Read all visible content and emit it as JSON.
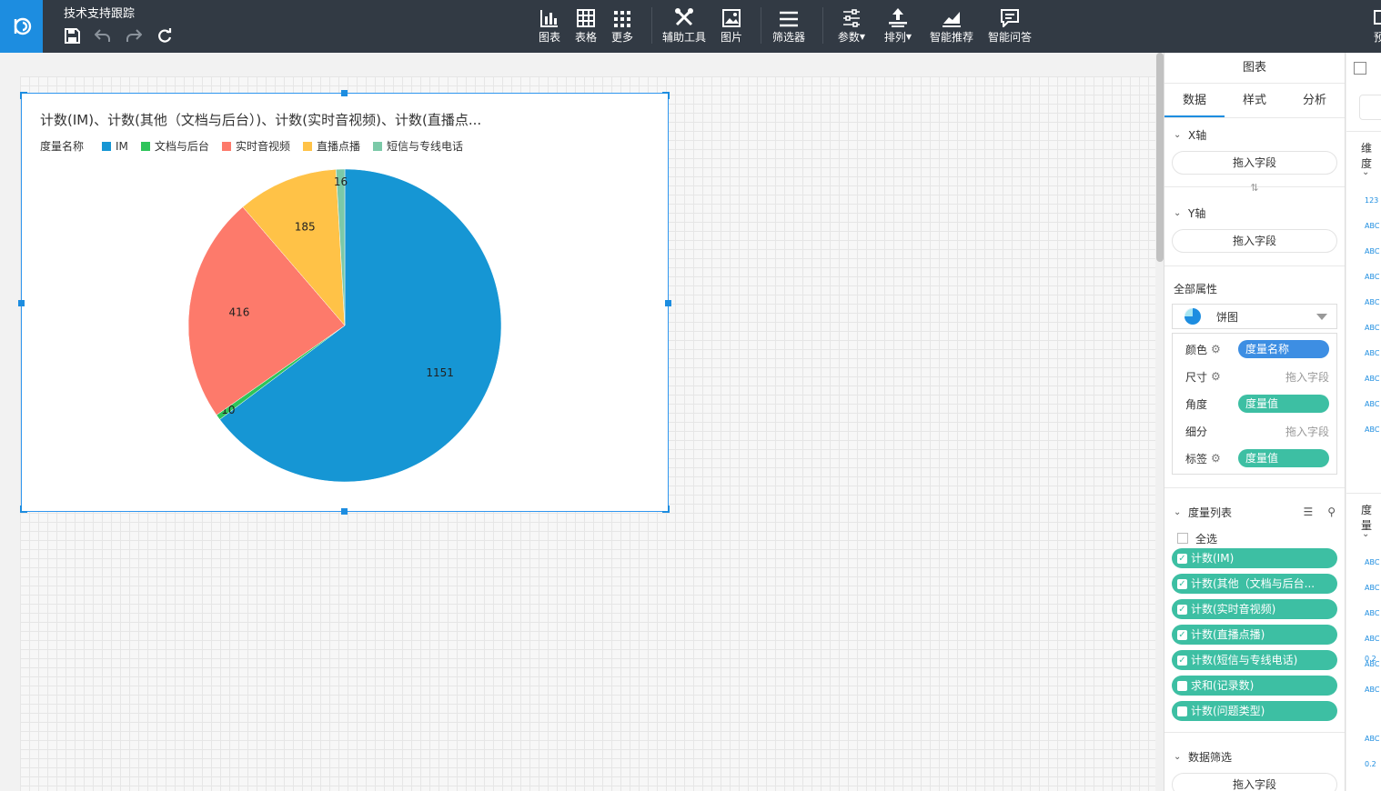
{
  "app": {
    "title": "技术支持跟踪"
  },
  "toolbar": {
    "tools": [
      {
        "id": "chart",
        "label": "图表",
        "icon": "bar-chart-icon"
      },
      {
        "id": "table",
        "label": "表格",
        "icon": "table-icon"
      },
      {
        "id": "more",
        "label": "更多",
        "icon": "grid-more-icon"
      },
      {
        "id": "aux",
        "label": "辅助工具",
        "icon": "tools-icon"
      },
      {
        "id": "image",
        "label": "图片",
        "icon": "image-icon"
      },
      {
        "id": "filter",
        "label": "筛选器",
        "icon": "filter-list-icon"
      },
      {
        "id": "param",
        "label": "参数",
        "icon": "sliders-icon"
      },
      {
        "id": "arrange",
        "label": "排列",
        "icon": "arrange-icon"
      },
      {
        "id": "recommend",
        "label": "智能推荐",
        "icon": "trend-chart-icon"
      },
      {
        "id": "qa",
        "label": "智能问答",
        "icon": "chat-icon"
      }
    ],
    "edge_text": "预"
  },
  "chart_widget": {
    "title": "计数(IM)、计数(其他（文档与后台）)、计数(实时音视频)、计数(直播点...",
    "legend_title": "度量名称"
  },
  "chart_data": {
    "type": "pie",
    "title": "计数(IM)、计数(其他（文档与后台）)、计数(实时音视频)、计数(直播点...",
    "legend": "top-left",
    "slices": [
      {
        "label": "IM",
        "value": 1151,
        "color": "#1696d4"
      },
      {
        "label": "文档与后台",
        "value": 10,
        "color": "#2ec45a"
      },
      {
        "label": "实时音视频",
        "value": 416,
        "color": "#fd7a6b"
      },
      {
        "label": "直播点播",
        "value": 185,
        "color": "#ffc247"
      },
      {
        "label": "短信与专线电话",
        "value": 16,
        "color": "#7bc9a8"
      }
    ]
  },
  "panel": {
    "header": "图表",
    "tabs": [
      "数据",
      "样式",
      "分析"
    ],
    "x_axis": {
      "label": "X轴",
      "placeholder": "拖入字段"
    },
    "y_axis": {
      "label": "Y轴",
      "placeholder": "拖入字段"
    },
    "all_props_label": "全部属性",
    "chart_type": "饼图",
    "props": [
      {
        "label": "颜色",
        "gear": true,
        "chip": "度量名称",
        "chip_color": "#3d8ee3"
      },
      {
        "label": "尺寸",
        "gear": true,
        "hint": "拖入字段"
      },
      {
        "label": "角度",
        "gear": false,
        "chip": "度量值",
        "chip_color": "#3dbfa3"
      },
      {
        "label": "细分",
        "gear": false,
        "hint": "拖入字段"
      },
      {
        "label": "标签",
        "gear": true,
        "chip": "度量值",
        "chip_color": "#3dbfa3"
      }
    ],
    "measure_list_label": "度量列表",
    "select_all": "全选",
    "measures": [
      {
        "label": "计数(IM)",
        "checked": true
      },
      {
        "label": "计数(其他（文档与后台...",
        "checked": true
      },
      {
        "label": "计数(实时音视频)",
        "checked": true
      },
      {
        "label": "计数(直播点播)",
        "checked": true
      },
      {
        "label": "计数(短信与专线电话)",
        "checked": true
      },
      {
        "label": "求和(记录数)",
        "checked": false
      },
      {
        "label": "计数(问题类型)",
        "checked": false
      }
    ],
    "data_filter_label": "数据筛选",
    "data_filter_placeholder": "拖入字段"
  },
  "side_strip": {
    "dimension_label": "维度",
    "measure_label": "度量",
    "mini_labels": [
      "123",
      "ABC",
      "ABC",
      "ABC",
      "ABC",
      "ABC",
      "ABC",
      "ABC",
      "ABC",
      "ABC",
      "ABC",
      "ABC",
      "ABC",
      "ABC",
      "ABC",
      "ABC",
      "ABC",
      "0.2",
      "0.2"
    ]
  }
}
